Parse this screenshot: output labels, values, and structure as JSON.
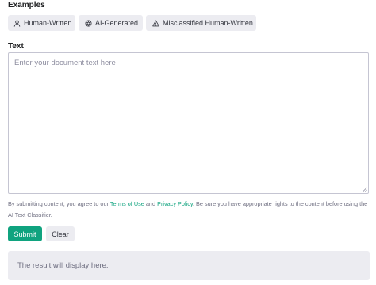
{
  "examples": {
    "title": "Examples",
    "buttons": [
      {
        "label": "Human-Written",
        "icon": "person-icon"
      },
      {
        "label": "AI-Generated",
        "icon": "openai-logo-icon"
      },
      {
        "label": "Misclassified Human-Written",
        "icon": "warning-triangle-icon"
      }
    ]
  },
  "text_section": {
    "title": "Text",
    "placeholder": "Enter your document text here",
    "value": ""
  },
  "disclaimer": {
    "prefix": "By submitting content, you agree to our ",
    "terms_link": "Terms of Use",
    "middle": " and ",
    "privacy_link": "Privacy Policy",
    "suffix": ". Be sure you have appropriate rights to the content before using the AI Text Classifier."
  },
  "actions": {
    "submit_label": "Submit",
    "clear_label": "Clear"
  },
  "result": {
    "text": "The result will display here."
  },
  "colors": {
    "accent": "#10a37f",
    "button_bg": "#ececf1",
    "muted_text": "#6e6e80"
  }
}
